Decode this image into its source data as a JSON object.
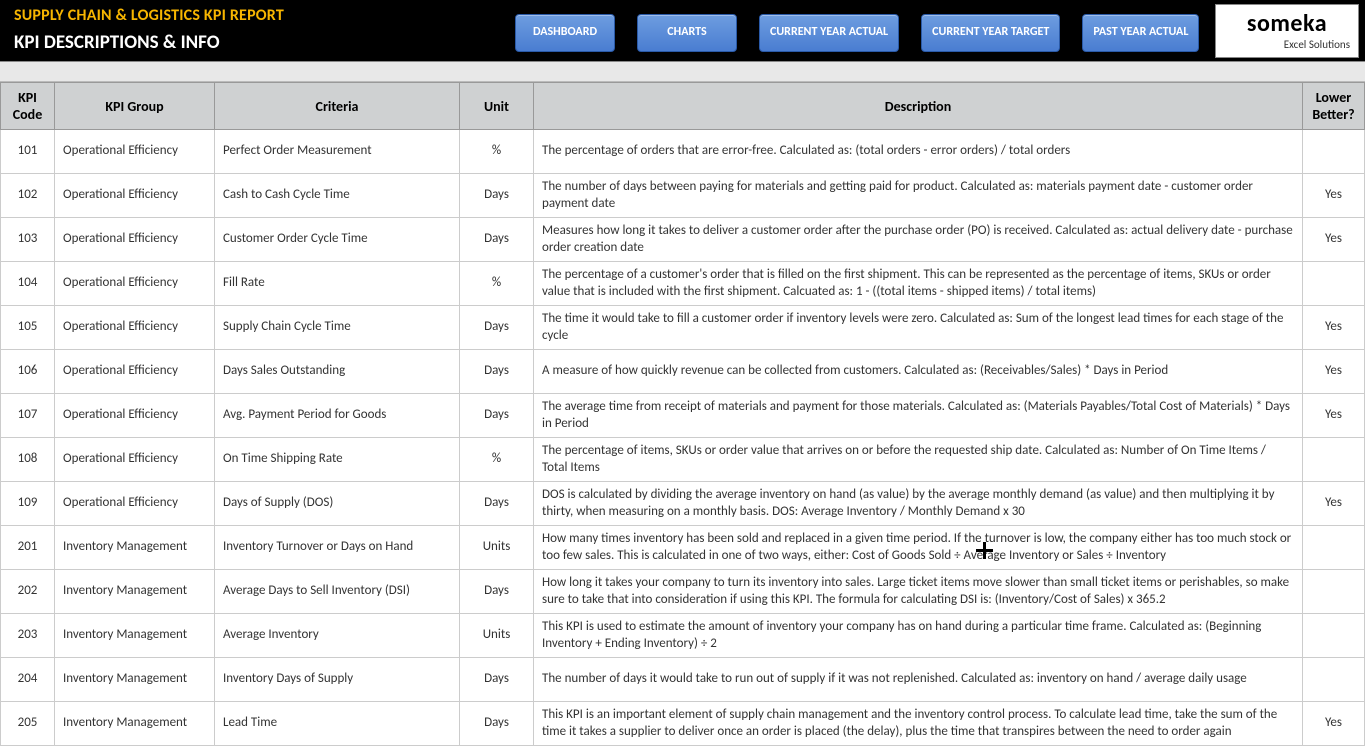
{
  "header": {
    "title": "SUPPLY CHAIN & LOGISTICS KPI REPORT",
    "subtitle": "KPI DESCRIPTIONS & INFO",
    "nav": [
      "DASHBOARD",
      "CHARTS",
      "CURRENT YEAR ACTUAL",
      "CURRENT YEAR TARGET",
      "PAST YEAR ACTUAL"
    ],
    "logo_brand": "someka",
    "logo_sub": "Excel Solutions"
  },
  "columns": [
    "KPI Code",
    "KPI Group",
    "Criteria",
    "Unit",
    "Description",
    "Lower Better?"
  ],
  "rows": [
    {
      "code": "101",
      "group": "Operational Efficiency",
      "criteria": "Perfect Order Measurement",
      "unit": "%",
      "desc": "The percentage of orders that are error-free. Calculated as: (total orders - error orders) / total orders",
      "lb": ""
    },
    {
      "code": "102",
      "group": "Operational Efficiency",
      "criteria": "Cash to Cash Cycle Time",
      "unit": "Days",
      "desc": "The number of days between paying for materials and getting paid for product. Calculated as: materials payment date - customer order payment date",
      "lb": "Yes"
    },
    {
      "code": "103",
      "group": "Operational Efficiency",
      "criteria": "Customer Order Cycle Time",
      "unit": "Days",
      "desc": "Measures how long it takes to deliver a customer order after the purchase order (PO) is received. Calculated as: actual delivery date - purchase order creation date",
      "lb": "Yes"
    },
    {
      "code": "104",
      "group": "Operational Efficiency",
      "criteria": "Fill Rate",
      "unit": "%",
      "desc": "The percentage of a customer's order that is filled on the first shipment. This can be represented as the percentage of items, SKUs or order value that is included with the first shipment. Calcuated as: 1 - ((total items - shipped items) / total items)",
      "lb": ""
    },
    {
      "code": "105",
      "group": "Operational Efficiency",
      "criteria": "Supply Chain Cycle Time",
      "unit": "Days",
      "desc": "The time it would take to fill a customer order if inventory levels were zero. Calculated as: Sum of the longest lead times for each stage of the cycle",
      "lb": "Yes"
    },
    {
      "code": "106",
      "group": "Operational Efficiency",
      "criteria": "Days Sales Outstanding",
      "unit": "Days",
      "desc": "A measure of how quickly revenue can be collected from customers. Calculated as: (Receivables/Sales) * Days in Period",
      "lb": "Yes"
    },
    {
      "code": "107",
      "group": "Operational Efficiency",
      "criteria": "Avg. Payment Period for Goods",
      "unit": "Days",
      "desc": "The average time from receipt of materials and payment for those materials. Calculated as: (Materials Payables/Total Cost of Materials) * Days in Period",
      "lb": "Yes"
    },
    {
      "code": "108",
      "group": "Operational Efficiency",
      "criteria": "On Time Shipping Rate",
      "unit": "%",
      "desc": "The percentage of items, SKUs or order value that arrives on or before the requested ship date. Calculated as: Number of On Time Items / Total Items",
      "lb": ""
    },
    {
      "code": "109",
      "group": "Operational Efficiency",
      "criteria": "Days of Supply (DOS)",
      "unit": "Days",
      "desc": "DOS is calculated by dividing the average inventory on hand (as value) by the average monthly demand (as value) and then multiplying it by thirty, when measuring on a monthly basis. DOS:  Average Inventory / Monthly Demand x 30",
      "lb": "Yes"
    },
    {
      "code": "201",
      "group": "Inventory Management",
      "criteria": "Inventory Turnover or Days on Hand",
      "unit": "Units",
      "desc": "How many times inventory has been sold and replaced in a given time period. If the turnover is low, the company either has too much stock or too few sales. This is calculated in one of two ways, either: Cost of Goods Sold ÷ Average Inventory or Sales ÷ Inventory",
      "lb": ""
    },
    {
      "code": "202",
      "group": "Inventory Management",
      "criteria": "Average Days to Sell Inventory (DSI)",
      "unit": "Days",
      "desc": "How long it takes your company to turn its inventory into sales. Large ticket items move slower than small ticket items or perishables, so make sure to take that into consideration if using this KPI. The formula for calculating DSI is: (Inventory/Cost of Sales) x 365.2",
      "lb": ""
    },
    {
      "code": "203",
      "group": "Inventory Management",
      "criteria": "Average Inventory",
      "unit": "Units",
      "desc": "This KPI is used to estimate the amount of inventory your company has on hand during a particular time frame. Calculated as: (Beginning Inventory + Ending Inventory) ÷ 2",
      "lb": ""
    },
    {
      "code": "204",
      "group": "Inventory Management",
      "criteria": "Inventory Days of Supply",
      "unit": "Days",
      "desc": "The number of days it would take to run out of supply if it was not replenished. Calculated as: inventory on hand / average daily usage",
      "lb": ""
    },
    {
      "code": "205",
      "group": "Inventory Management",
      "criteria": "Lead Time",
      "unit": "Days",
      "desc": "This KPI is an important element of supply chain management and the inventory control process. To calculate lead time, take the sum of the time it takes a supplier to deliver once an order is placed (the delay), plus the time that transpires between the need to order again",
      "lb": "Yes"
    }
  ],
  "cursor": {
    "row_index": 9
  }
}
